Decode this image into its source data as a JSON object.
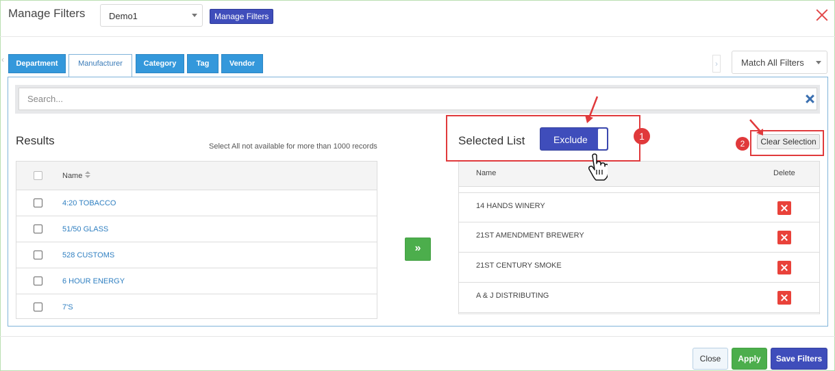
{
  "header": {
    "title": "Manage Filters",
    "preset_value": "Demo1",
    "manage_button": "Manage Filters"
  },
  "tabs": [
    {
      "label": "Department",
      "active": false
    },
    {
      "label": "Manufacturer",
      "active": true
    },
    {
      "label": "Category",
      "active": false
    },
    {
      "label": "Tag",
      "active": false
    },
    {
      "label": "Vendor",
      "active": false
    }
  ],
  "match_select": {
    "value": "Match All Filters"
  },
  "search": {
    "placeholder": "Search..."
  },
  "results": {
    "title": "Results",
    "note": "Select All not available for more than 1000 records",
    "column_name": "Name",
    "rows": [
      "4:20 TOBACCO",
      "51/50 GLASS",
      "528 CUSTOMS",
      "6 HOUR ENERGY",
      "7'S"
    ]
  },
  "move_button": {
    "label": "»"
  },
  "selected": {
    "title": "Selected List",
    "toggle_label": "Exclude",
    "clear_button": "Clear Selection",
    "column_name": "Name",
    "column_delete": "Delete",
    "rows": [
      "14 HANDS WINERY",
      "21ST AMENDMENT BREWERY",
      "21ST CENTURY SMOKE",
      "A & J DISTRIBUTING"
    ]
  },
  "annotations": {
    "badge1": "1",
    "badge2": "2"
  },
  "footer": {
    "close": "Close",
    "apply": "Apply",
    "save": "Save Filters"
  },
  "colors": {
    "primary": "#3f4dbb",
    "tab_blue": "#3498db",
    "success": "#4cae4c",
    "danger": "#e9423a",
    "annotation_red": "#e0393b"
  }
}
